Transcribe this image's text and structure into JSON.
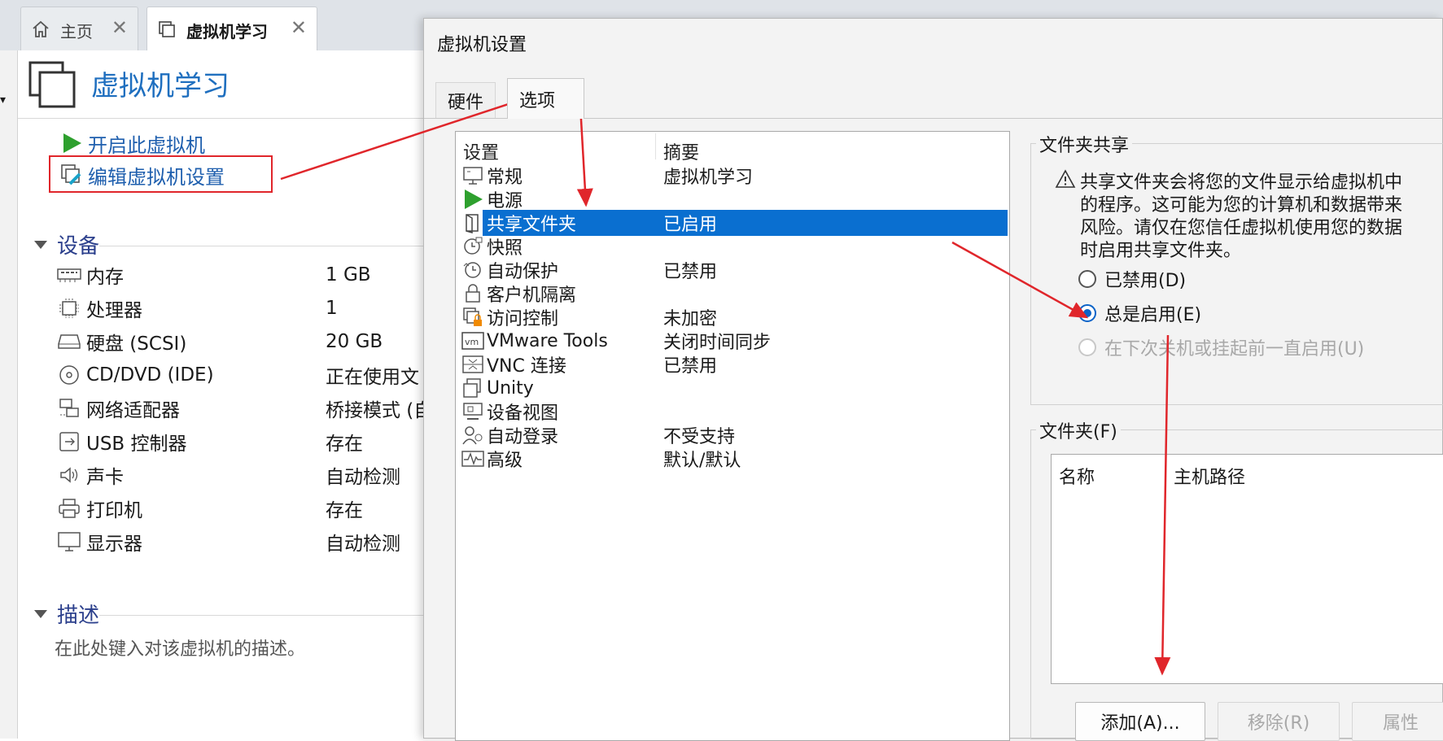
{
  "tabs": [
    {
      "label": "主页",
      "icon": "home-icon"
    },
    {
      "label": "虚拟机学习",
      "icon": "vm-icon"
    }
  ],
  "vm": {
    "title": "虚拟机学习",
    "commands": {
      "start": "开启此虚拟机",
      "edit": "编辑虚拟机设置"
    },
    "devices_header": "设备",
    "devices": [
      {
        "name": "内存",
        "value": "1 GB",
        "icon": "memory-icon"
      },
      {
        "name": "处理器",
        "value": "1",
        "icon": "cpu-icon"
      },
      {
        "name": "硬盘 (SCSI)",
        "value": "20 GB",
        "icon": "hard-disk-icon"
      },
      {
        "name": "CD/DVD (IDE)",
        "value": "正在使用文",
        "icon": "cd-dvd-icon"
      },
      {
        "name": "网络适配器",
        "value": "桥接模式 (自",
        "icon": "network-icon"
      },
      {
        "name": "USB 控制器",
        "value": "存在",
        "icon": "usb-icon"
      },
      {
        "name": "声卡",
        "value": "自动检测",
        "icon": "speaker-icon"
      },
      {
        "name": "打印机",
        "value": "存在",
        "icon": "printer-icon"
      },
      {
        "name": "显示器",
        "value": "自动检测",
        "icon": "monitor-icon"
      }
    ],
    "description_header": "描述",
    "description_placeholder": "在此处键入对该虚拟机的描述。"
  },
  "dialog": {
    "title": "虚拟机设置",
    "tabs": [
      "硬件",
      "选项"
    ],
    "list_headers": {
      "setting": "设置",
      "summary": "摘要"
    },
    "options": [
      {
        "name": "常规",
        "summary": "虚拟机学习",
        "icon": "general-icon"
      },
      {
        "name": "电源",
        "summary": "",
        "icon": "power-icon"
      },
      {
        "name": "共享文件夹",
        "summary": "已启用",
        "icon": "shared-folder-icon"
      },
      {
        "name": "快照",
        "summary": "",
        "icon": "snapshot-icon"
      },
      {
        "name": "自动保护",
        "summary": "已禁用",
        "icon": "autoprotect-icon"
      },
      {
        "name": "客户机隔离",
        "summary": "",
        "icon": "lock-icon"
      },
      {
        "name": "访问控制",
        "summary": "未加密",
        "icon": "access-control-icon"
      },
      {
        "name": "VMware Tools",
        "summary": "关闭时间同步",
        "icon": "vmware-tools-icon"
      },
      {
        "name": "VNC 连接",
        "summary": "已禁用",
        "icon": "vnc-icon"
      },
      {
        "name": "Unity",
        "summary": "",
        "icon": "unity-icon"
      },
      {
        "name": "设备视图",
        "summary": "",
        "icon": "device-view-icon"
      },
      {
        "name": "自动登录",
        "summary": "不受支持",
        "icon": "autologin-icon"
      },
      {
        "name": "高级",
        "summary": "默认/默认",
        "icon": "advanced-icon"
      }
    ],
    "selected_option": 2,
    "sharing": {
      "label": "文件夹共享",
      "warning_lines": [
        "共享文件夹会将您的文件显示给虚拟机中",
        "的程序。这可能为您的计算机和数据带来",
        "风险。请仅在您信任虚拟机使用您的数据",
        "时启用共享文件夹。"
      ],
      "options": [
        {
          "label": "已禁用(D)",
          "state": "unchecked"
        },
        {
          "label": "总是启用(E)",
          "state": "checked"
        },
        {
          "label": "在下次关机或挂起前一直启用(U)",
          "state": "disabled"
        }
      ]
    },
    "folders": {
      "label": "文件夹(F)",
      "columns": [
        "名称",
        "主机路径"
      ],
      "buttons": {
        "add": "添加(A)...",
        "remove": "移除(R)",
        "properties": "属性"
      }
    }
  },
  "colors": {
    "accent": "#0a6fd0",
    "link": "#1f5fae",
    "annotation": "#e0262b"
  }
}
